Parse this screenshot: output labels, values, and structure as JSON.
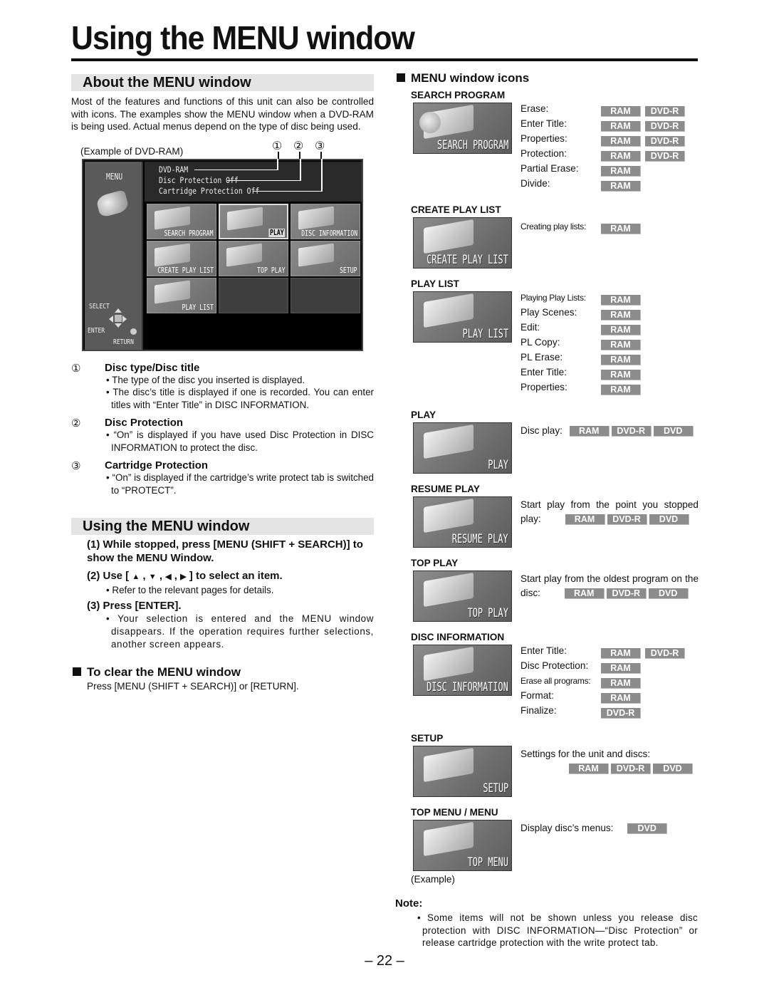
{
  "page": {
    "title": "Using the MENU window",
    "page_number": "– 22 –"
  },
  "about": {
    "heading": "About the MENU window",
    "intro": "Most of the features and functions of this unit can also be controlled with icons. The examples show the MENU window when a DVD-RAM is being used. Actual menus depend on the type of disc being used.",
    "example_label": "(Example of DVD-RAM)",
    "callouts": [
      "①",
      "②",
      "③"
    ],
    "screen": {
      "menu_label": "MENU",
      "header_lines": [
        "DVD-RAM",
        "Disc Protection  Off",
        "Cartridge Protection  Off"
      ],
      "tiles": [
        "SEARCH PROGRAM",
        "PLAY",
        "DISC INFORMATION",
        "CREATE PLAY LIST",
        "TOP PLAY",
        "SETUP",
        "PLAY LIST",
        "",
        ""
      ],
      "selected_tile": "PLAY",
      "select_label": "SELECT",
      "enter_label": "ENTER",
      "return_label": "RETURN"
    },
    "items": [
      {
        "num": "①",
        "title": "Disc type/Disc title",
        "bullets": [
          "The type of the disc you inserted is displayed.",
          "The disc’s title is displayed if one is recorded. You can enter titles with “Enter Title” in DISC INFORMATION."
        ]
      },
      {
        "num": "②",
        "title": "Disc Protection",
        "bullets": [
          "“On” is displayed if you have used Disc Protection in DISC INFORMATION to protect the disc."
        ]
      },
      {
        "num": "③",
        "title": "Cartridge Protection",
        "bullets": [
          "“On” is displayed if the cartridge’s write protect tab is switched to “PROTECT”."
        ]
      }
    ]
  },
  "using": {
    "heading": "Using the MENU window",
    "step1": "(1) While stopped, press [MENU (SHIFT + SEARCH)] to show the MENU Window.",
    "step2_prefix": "(2) Use [",
    "step2_arrows": [
      "▲",
      "▼",
      "◀",
      "▶"
    ],
    "step2_suffix": "] to select an item.",
    "step2_sub": "Refer to the relevant pages for details.",
    "step3": "(3) Press [ENTER].",
    "step3_sub": "Your selection is entered and the MENU window disappears. If the operation requires further selections, another screen appears."
  },
  "clear": {
    "heading": "To clear the MENU window",
    "text": "Press [MENU (SHIFT + SEARCH)] or [RETURN]."
  },
  "icons": {
    "heading": "MENU window icons",
    "groups": [
      {
        "label": "SEARCH PROGRAM",
        "caption": "SEARCH PROGRAM",
        "rows": [
          {
            "text": "Erase:",
            "badges": [
              "RAM",
              "DVD-R"
            ]
          },
          {
            "text": "Enter Title:",
            "badges": [
              "RAM",
              "DVD-R"
            ]
          },
          {
            "text": "Properties:",
            "badges": [
              "RAM",
              "DVD-R"
            ]
          },
          {
            "text": "Protection:",
            "badges": [
              "RAM",
              "DVD-R"
            ]
          },
          {
            "text": "Partial Erase:",
            "badges": [
              "RAM"
            ]
          },
          {
            "text": "Divide:",
            "badges": [
              "RAM"
            ]
          }
        ]
      },
      {
        "label": "CREATE PLAY LIST",
        "caption": "CREATE PLAY LIST",
        "rows": [
          {
            "text": "Creating play lists:",
            "badges": [
              "RAM"
            ]
          }
        ]
      },
      {
        "label": "PLAY LIST",
        "caption": "PLAY LIST",
        "rows": [
          {
            "text": "Playing Play Lists:",
            "badges": [
              "RAM"
            ]
          },
          {
            "text": "Play Scenes:",
            "badges": [
              "RAM"
            ]
          },
          {
            "text": "Edit:",
            "badges": [
              "RAM"
            ]
          },
          {
            "text": "PL Copy:",
            "badges": [
              "RAM"
            ]
          },
          {
            "text": "PL Erase:",
            "badges": [
              "RAM"
            ]
          },
          {
            "text": "Enter Title:",
            "badges": [
              "RAM"
            ]
          },
          {
            "text": "Properties:",
            "badges": [
              "RAM"
            ]
          }
        ]
      },
      {
        "label": "PLAY",
        "caption": "PLAY",
        "desc": "Disc play:",
        "badges": [
          "RAM",
          "DVD-R",
          "DVD"
        ]
      },
      {
        "label": "RESUME PLAY",
        "caption": "RESUME PLAY",
        "desc": "Start play from the point you stopped play:",
        "badges": [
          "RAM",
          "DVD-R",
          "DVD"
        ]
      },
      {
        "label": "TOP PLAY",
        "caption": "TOP PLAY",
        "desc": "Start play from the oldest program on the disc:",
        "badges": [
          "RAM",
          "DVD-R",
          "DVD"
        ]
      },
      {
        "label": "DISC INFORMATION",
        "caption": "DISC INFORMATION",
        "rows": [
          {
            "text": "Enter Title:",
            "badges": [
              "RAM",
              "DVD-R"
            ]
          },
          {
            "text": "Disc Protection:",
            "badges": [
              "RAM"
            ]
          },
          {
            "text": "Erase all programs:",
            "badges": [
              "RAM"
            ]
          },
          {
            "text": "Format:",
            "badges": [
              "RAM"
            ]
          },
          {
            "text": "Finalize:",
            "badges": [
              "DVD-R"
            ]
          }
        ]
      },
      {
        "label": "SETUP",
        "caption": "SETUP",
        "desc": "Settings for the unit and discs:",
        "badges": [
          "RAM",
          "DVD-R",
          "DVD"
        ]
      },
      {
        "label": "TOP MENU / MENU",
        "caption": "TOP MENU",
        "desc": "Display disc’s menus:",
        "badges": [
          "DVD"
        ],
        "footnote": "(Example)"
      }
    ]
  },
  "note": {
    "heading": "Note:",
    "text": "Some items will not be shown unless you release disc protection with DISC INFORMATION—“Disc Protection” or release cartridge protection with the write protect tab."
  },
  "colors": {
    "badge_bg": "#8c8c8c",
    "badge_text": "#ffffff",
    "section_band": "#e4e4e4"
  }
}
